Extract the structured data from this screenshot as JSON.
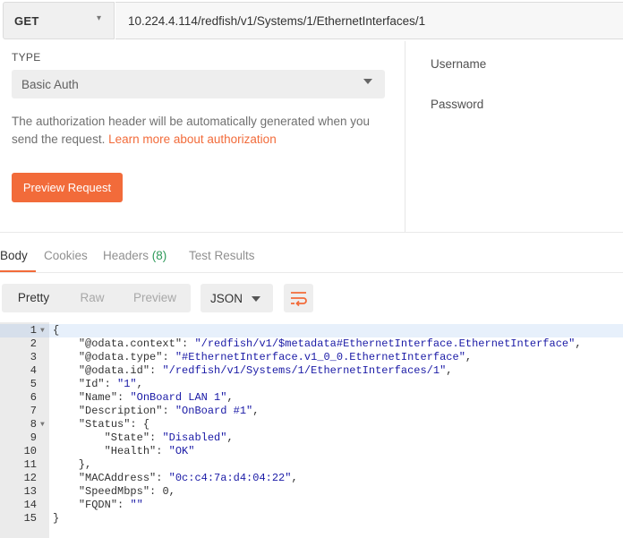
{
  "request": {
    "method": "GET",
    "url": "10.224.4.114/redfish/v1/Systems/1/EthernetInterfaces/1"
  },
  "auth": {
    "type_label": "TYPE",
    "type_value": "Basic Auth",
    "description": "The authorization header will be automatically generated when you send the request. ",
    "link_text": "Learn more about authorization",
    "preview_button": "Preview Request",
    "username_label": "Username",
    "password_label": "Password"
  },
  "response_tabs": {
    "body": "Body",
    "cookies": "Cookies",
    "headers": "Headers",
    "headers_count": "(8)",
    "test_results": "Test Results"
  },
  "view": {
    "pretty": "Pretty",
    "raw": "Raw",
    "preview": "Preview",
    "format": "JSON"
  },
  "code": {
    "lines": [
      "{",
      "    \"@odata.context\": \"/redfish/v1/$metadata#EthernetInterface.EthernetInterface\",",
      "    \"@odata.type\": \"#EthernetInterface.v1_0_0.EthernetInterface\",",
      "    \"@odata.id\": \"/redfish/v1/Systems/1/EthernetInterfaces/1\",",
      "    \"Id\": \"1\",",
      "    \"Name\": \"OnBoard LAN 1\",",
      "    \"Description\": \"OnBoard #1\",",
      "    \"Status\": {",
      "        \"State\": \"Disabled\",",
      "        \"Health\": \"OK\"",
      "    },",
      "    \"MACAddress\": \"0c:c4:7a:d4:04:22\",",
      "    \"SpeedMbps\": 0,",
      "    \"FQDN\": \"\"",
      "}"
    ],
    "line_numbers": [
      "1",
      "2",
      "3",
      "4",
      "5",
      "6",
      "7",
      "8",
      "9",
      "10",
      "11",
      "12",
      "13",
      "14",
      "15"
    ],
    "fold_lines": [
      1,
      8
    ],
    "active_line": 1
  },
  "colors": {
    "accent": "#f26b3a",
    "count_green": "#2e9a5a",
    "string_blue": "#1a1aa6"
  }
}
